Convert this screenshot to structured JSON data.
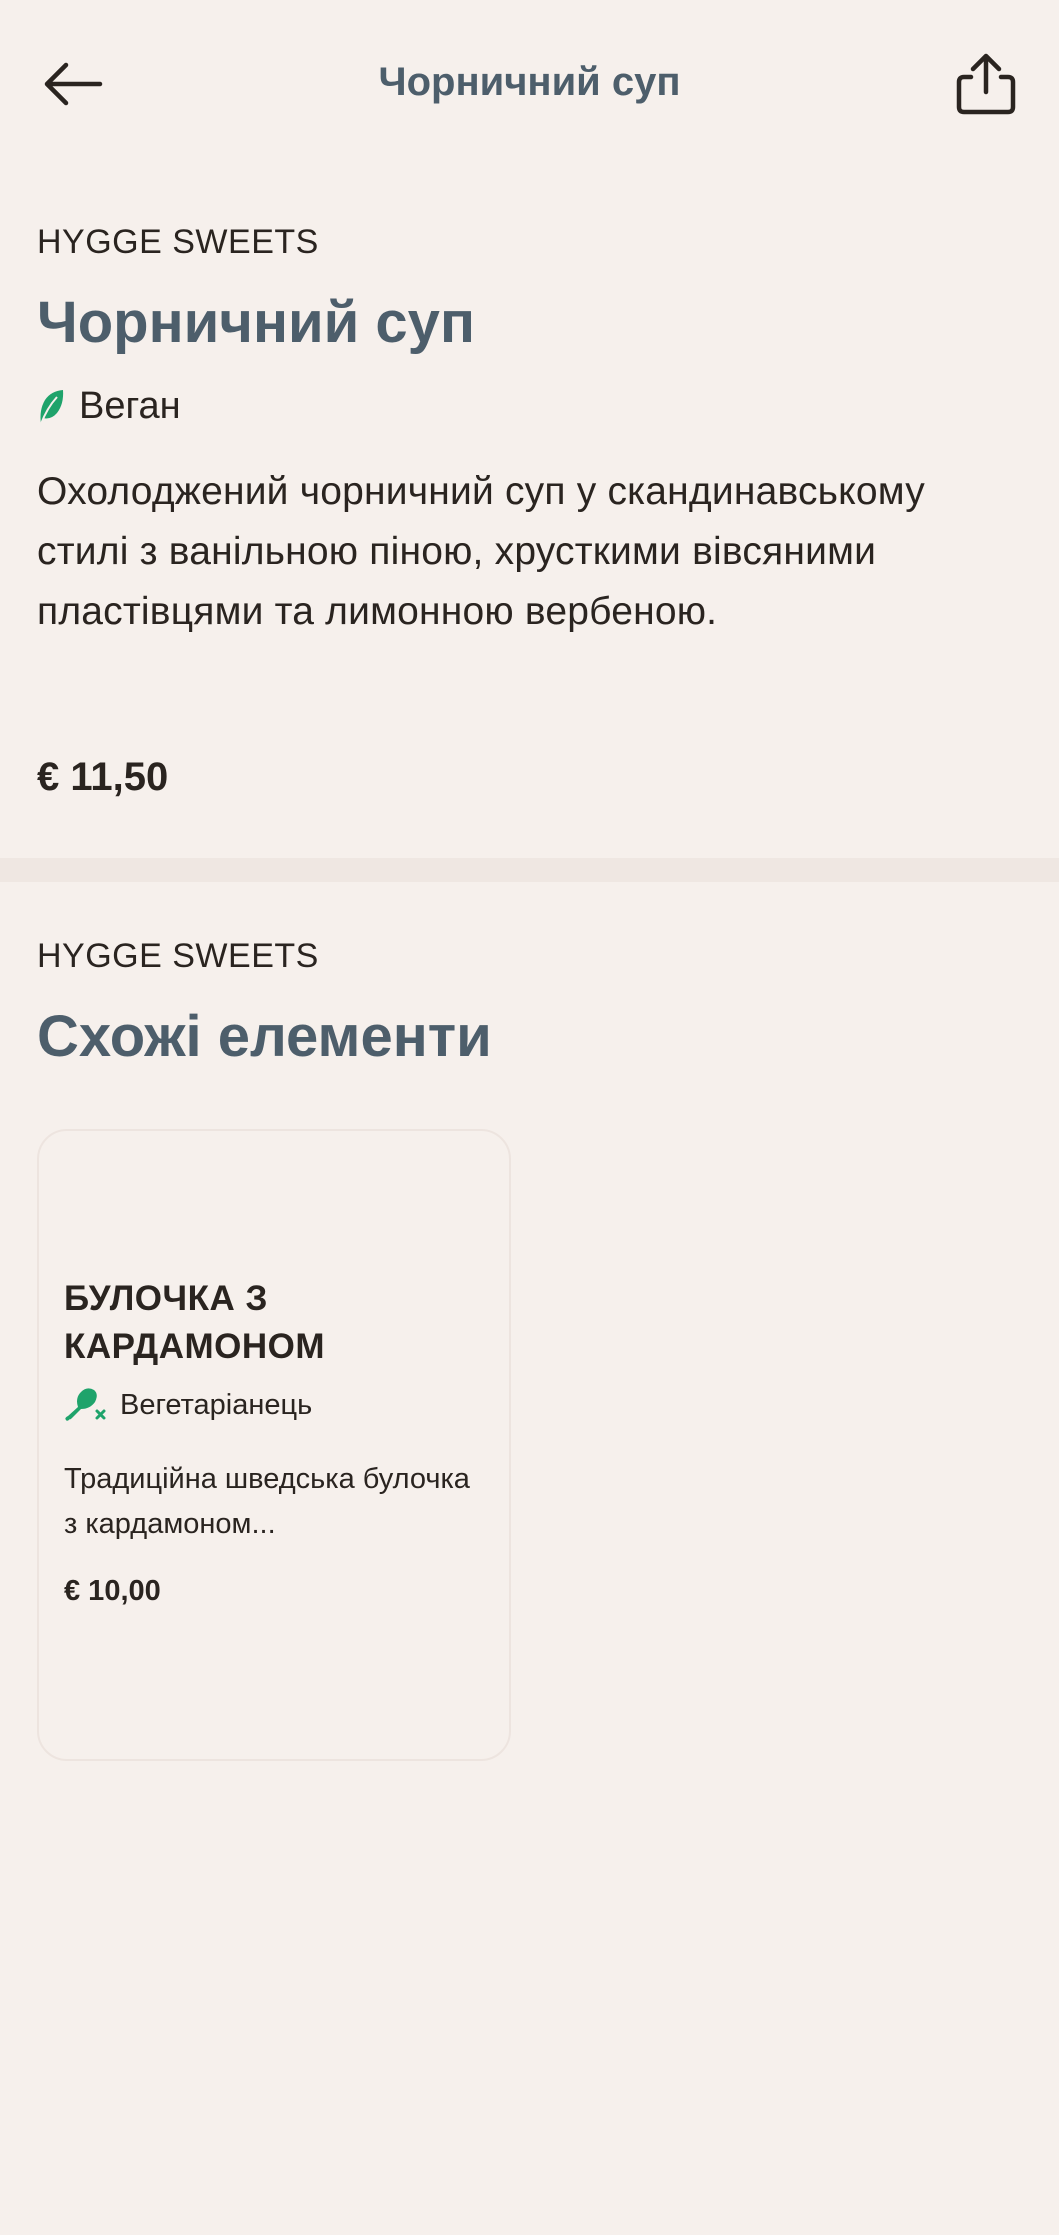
{
  "header": {
    "title": "Чорничний суп",
    "back_icon": "arrow-left-icon",
    "share_icon": "share-icon"
  },
  "product": {
    "brand": "HYGGE SWEETS",
    "title": "Чорничний суп",
    "diet_label": "Веган",
    "diet_icon": "leaf-icon",
    "description": "Охолоджений чорничний суп у скандинавському стилі з ванільною піною, хрусткими вівсяними пластівцями та лимонною вербеною.",
    "price": "€ 11,50"
  },
  "similar": {
    "brand": "HYGGE SWEETS",
    "title": "Схожі елементи",
    "items": [
      {
        "title": "БУЛОЧКА З КАРДАМОНОМ",
        "diet_label": "Вегетаріанець",
        "diet_icon": "no-meat-icon",
        "description": "Традиційна шведська булочка з кардамоном...",
        "price": "€ 10,00"
      }
    ]
  },
  "colors": {
    "background": "#f6f0ec",
    "heading": "#4d5e6b",
    "text": "#2a2420",
    "accent_green": "#1fa36b"
  }
}
